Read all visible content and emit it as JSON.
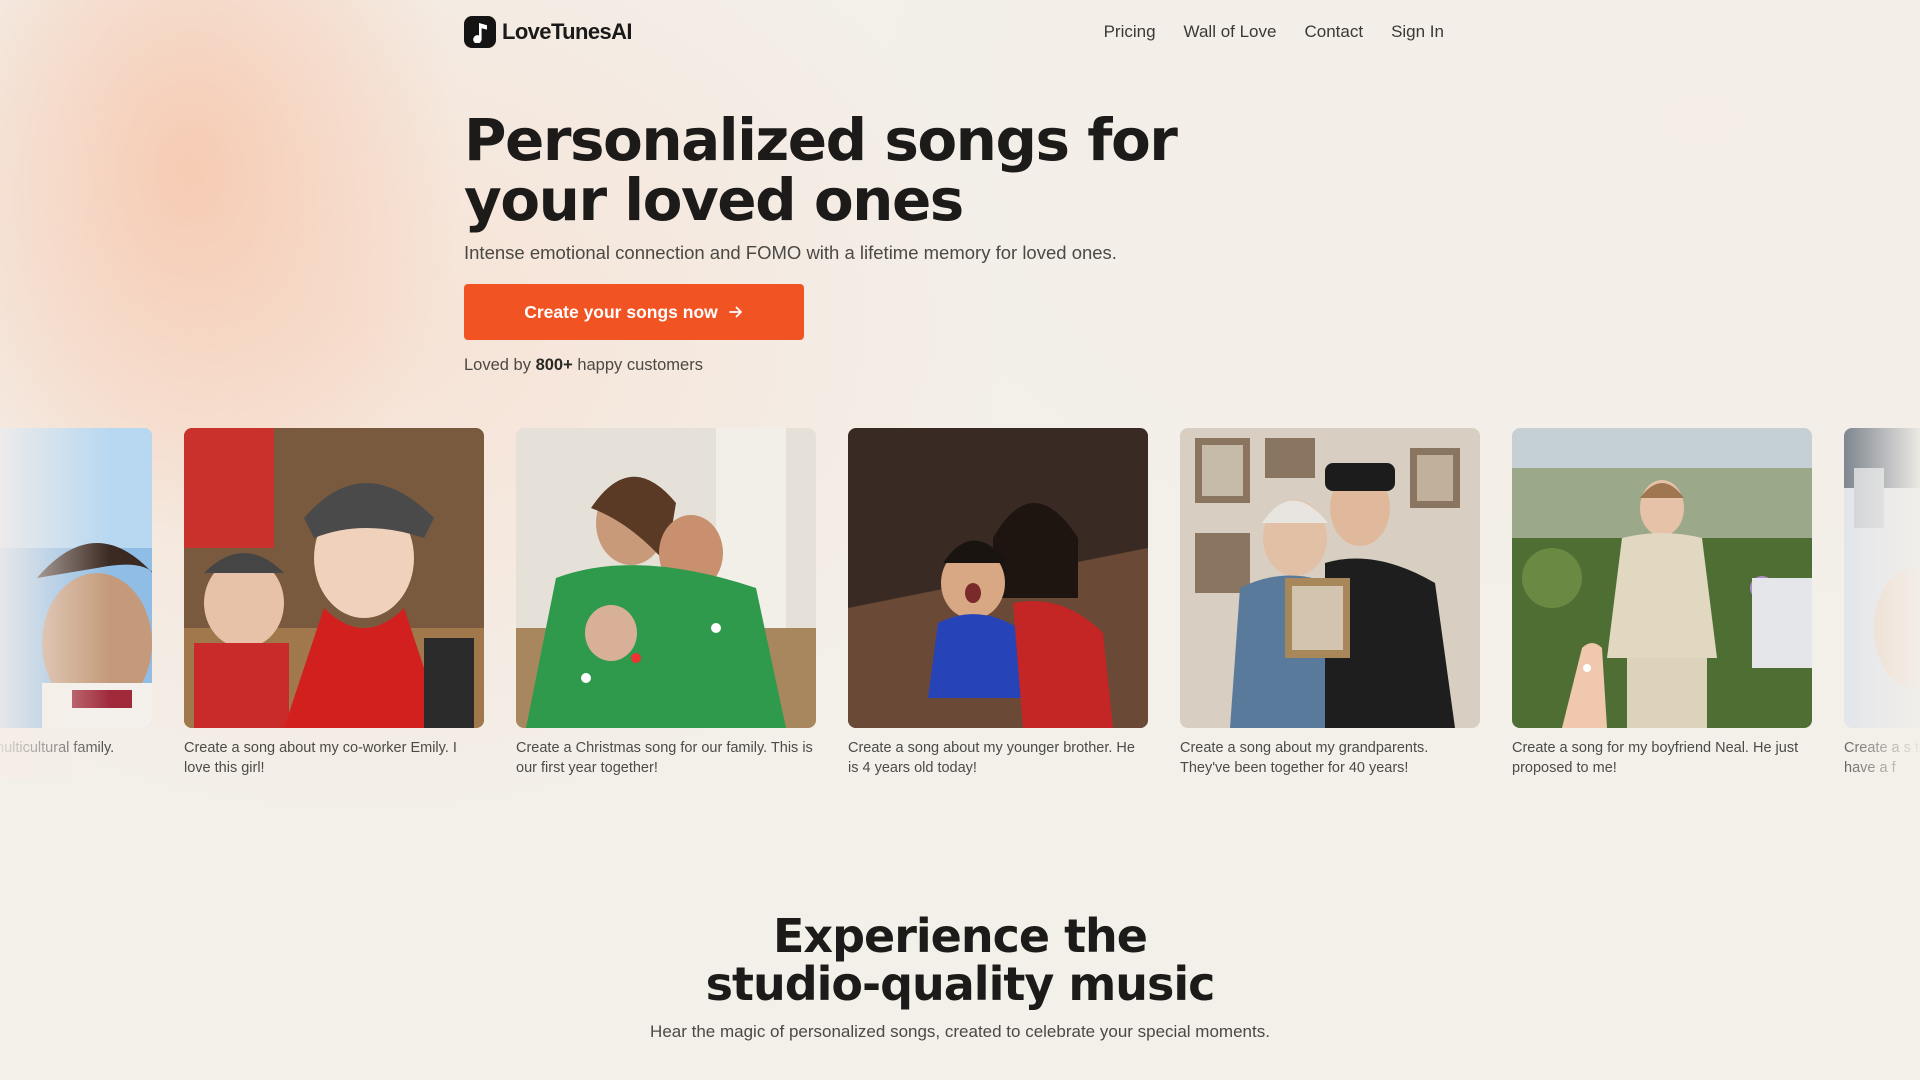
{
  "nav": {
    "brand": "LoveTunesAI",
    "links": [
      "Pricing",
      "Wall of Love",
      "Contact",
      "Sign In"
    ]
  },
  "hero": {
    "title_line1": "Personalized songs for",
    "title_line2": "your loved ones",
    "subtitle": "Intense emotional connection and FOMO with a lifetime memory for loved ones.",
    "cta_label": "Create your songs now",
    "loved_prefix": "Loved by",
    "loved_count": "800+",
    "loved_suffix": "happy customers"
  },
  "gallery": [
    {
      "caption": "multicultural family."
    },
    {
      "caption": "Create a song about my co-worker Emily. I love this girl!"
    },
    {
      "caption": "Create a Christmas song for our family. This is our first year together!"
    },
    {
      "caption": "Create a song about my younger brother. He is 4 years old today!"
    },
    {
      "caption": "Create a song about my grandparents. They've been together for 40 years!"
    },
    {
      "caption": "Create a song for my boyfriend Neal. He just proposed to me!"
    },
    {
      "caption": "Create a s to have a f"
    }
  ],
  "section2": {
    "title_line1": "Experience the",
    "title_line2": "studio-quality music",
    "subtitle": "Hear the magic of personalized songs, created to celebrate your special moments."
  },
  "colors": {
    "accent": "#f25322",
    "background": "#f3efe9",
    "text": "#1c1b1a"
  },
  "icons": [
    "music-note-logo-icon",
    "arrow-right-icon"
  ]
}
